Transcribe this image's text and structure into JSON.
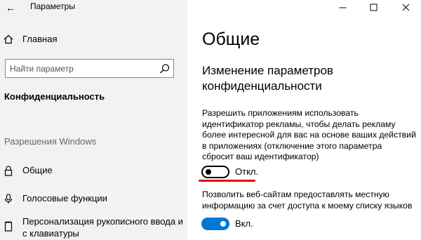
{
  "window": {
    "title": "Параметры"
  },
  "sidebar": {
    "home_label": "Главная",
    "search_placeholder": "Найти параметр",
    "current_section": "Конфиденциальность",
    "group_header": "Разрешения Windows",
    "items": [
      {
        "label": "Общие",
        "icon": "lock-icon"
      },
      {
        "label": "Голосовые функции",
        "icon": "microphone-icon"
      },
      {
        "label": "Персонализация рукописного ввода и",
        "label_line2": "с клавиатуры",
        "icon": "notepad-icon"
      }
    ]
  },
  "main": {
    "title": "Общие",
    "subheading_line1": "Изменение параметров",
    "subheading_line2": "конфиденциальности",
    "settings": [
      {
        "lines": [
          "Разрешить приложениям использовать",
          "идентификатор рекламы, чтобы делать рекламу",
          "более интересной для вас на основе ваших действий",
          "в приложениях (отключение этого параметра",
          "сбросит ваш идентификатор)"
        ],
        "state": "off",
        "state_label": "Откл."
      },
      {
        "lines": [
          "Позволить веб-сайтам предоставлять местную",
          "информацию за счет доступа к моему списку языков"
        ],
        "state": "on",
        "state_label": "Вкл."
      }
    ]
  },
  "colors": {
    "accent": "#0078d7",
    "highlight_underline": "#e01010",
    "sidebar_bg": "#f2f2f2"
  }
}
